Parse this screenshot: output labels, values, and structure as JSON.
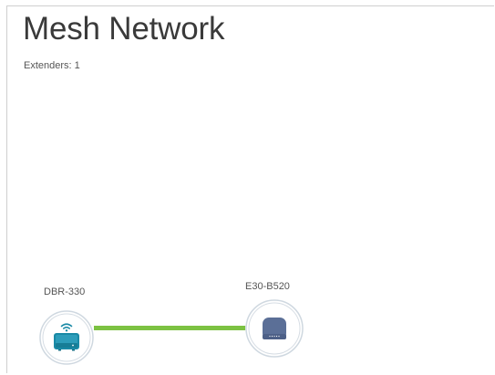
{
  "header": {
    "title": "Mesh Network",
    "extenders_text": "Extenders: 1"
  },
  "topology": {
    "router": {
      "label": "DBR-330",
      "icon": "router-wifi-icon",
      "accent": "#1a8aa6"
    },
    "extender": {
      "label": "E30-B520",
      "icon": "extender-device-icon",
      "accent": "#5b6f97"
    },
    "link": {
      "status_color": "#7cc242"
    }
  }
}
